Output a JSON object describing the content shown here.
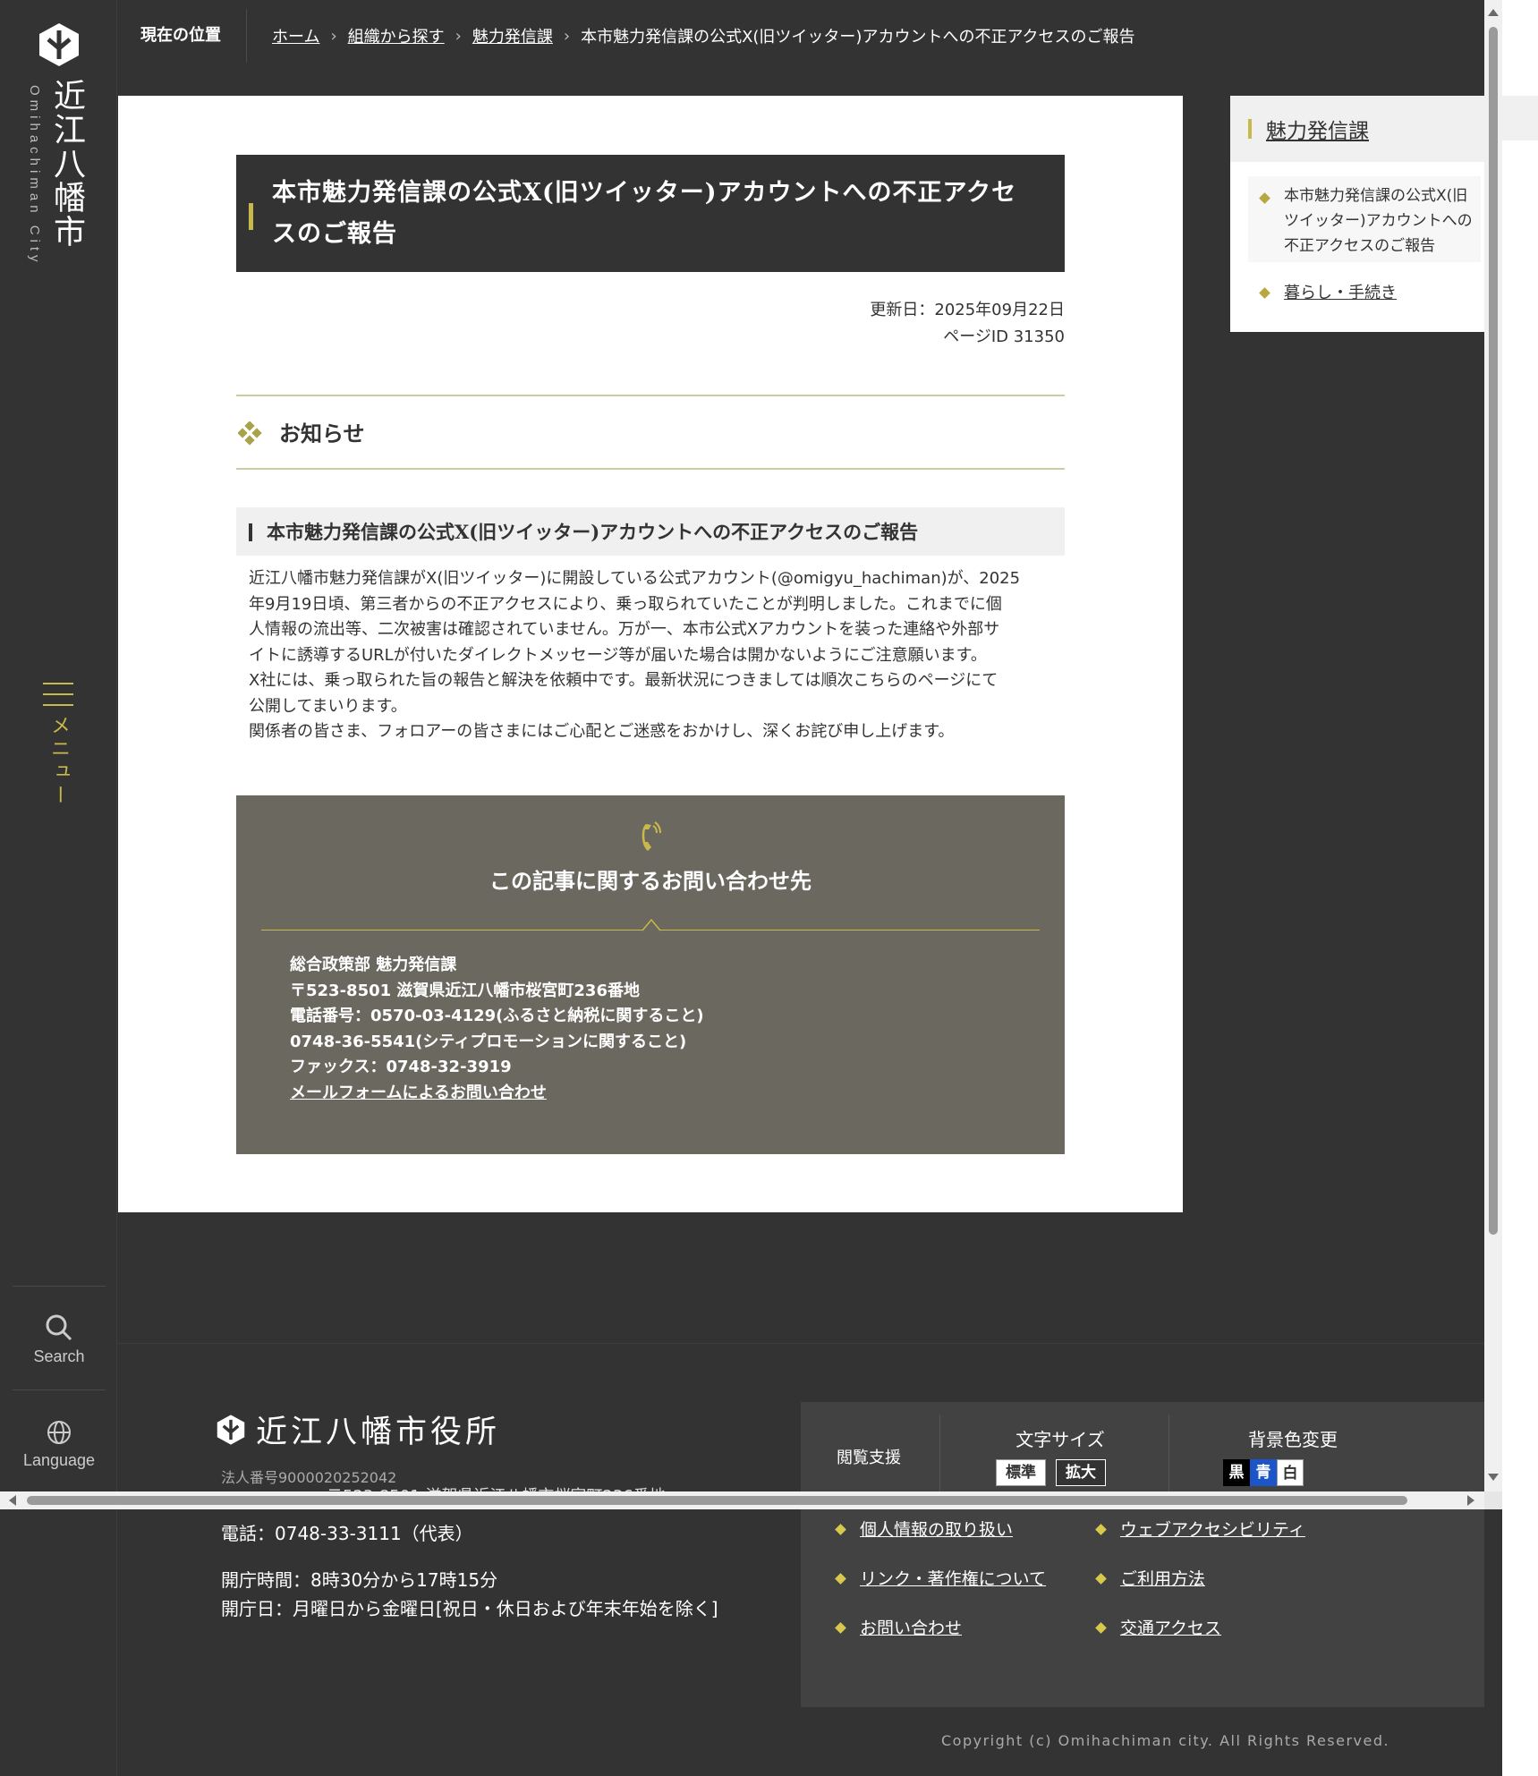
{
  "logo": {
    "name_jp": "近江八幡市",
    "name_en": "Omihachiman City"
  },
  "sidenav": {
    "menu_label": "メニュー",
    "search_label": "Search",
    "language_label": "Language"
  },
  "breadcrumb": {
    "label": "現在の位置",
    "items": [
      "ホーム",
      "組織から探す",
      "魅力発信課"
    ],
    "current": "本市魅力発信課の公式X(旧ツイッター)アカウントへの不正アクセスのご報告"
  },
  "article": {
    "title": "本市魅力発信課の公式X(旧ツイッター)アカウントへの不正アクセスのご報告",
    "updated": "更新日：2025年09月22日",
    "page_id": "ページID 31350",
    "section_heading": "お知らせ",
    "subheading": "本市魅力発信課の公式X(旧ツイッター)アカウントへの不正アクセスのご報告",
    "body_lines": [
      "近江八幡市魅力発信課がX(旧ツイッター)に開設している公式アカウント(@omigyu_hachiman)が、2025",
      "年9月19日頃、第三者からの不正アクセスにより、乗っ取られていたことが判明しました。これまでに個",
      "人情報の流出等、二次被害は確認されていません。万が一、本市公式Xアカウントを装った連絡や外部サ",
      "イトに誘導するURLが付いたダイレクトメッセージ等が届いた場合は開かないようにご注意願います。",
      "X社には、乗っ取られた旨の報告と解決を依頼中です。最新状況につきましては順次こちらのページにて",
      "公開してまいります。",
      "関係者の皆さま、フォロアーの皆さまにはご心配とご迷惑をおかけし、深くお詫び申し上げます。"
    ]
  },
  "contact": {
    "title": "この記事に関するお問い合わせ先",
    "dept": "総合政策部  魅力発信課",
    "address": "〒523-8501 滋賀県近江八幡市桜宮町236番地",
    "tel1": "電話番号：0570-03-4129(ふるさと納税に関すること)",
    "tel2": "0748-36-5541(シティプロモーションに関すること)",
    "fax": "ファックス：0748-32-3919",
    "mail_link": "メールフォームによるお問い合わせ"
  },
  "sidebar": {
    "heading": "魅力発信課",
    "current_item": "本市魅力発信課の公式X(旧ツイッター)アカウントへの不正アクセスのご報告",
    "link": "暮らし・手続き"
  },
  "footer": {
    "office_name": "近江八幡市役所",
    "corp_number": "法人番号9000020252042",
    "address_partial": "〒523-8501 滋賀県近江八幡市桜宮町236番地",
    "tel": "電話：0748-33-3111（代表）",
    "hours": "開庁時間：8時30分から17時15分",
    "days": "開庁日：月曜日から金曜日[祝日・休日および年末年始を除く]",
    "access_label": "閲覧支援",
    "font_size_label": "文字サイズ",
    "font_standard": "標準",
    "font_large": "拡大",
    "bg_label": "背景色変更",
    "bg_black": "黒",
    "bg_blue": "青",
    "bg_white": "白",
    "links": [
      "個人情報の取り扱い",
      "ウェブアクセシビリティ",
      "リンク・著作権について",
      "ご利用方法",
      "お問い合わせ",
      "交通アクセス"
    ],
    "copyright": "Copyright (c) Omihachiman city. All Rights Reserved."
  },
  "colors": {
    "accent_gold": "#c9b84a",
    "dark_bg": "#333333",
    "contact_bg": "#6b6860",
    "panel_bg": "#424242"
  }
}
